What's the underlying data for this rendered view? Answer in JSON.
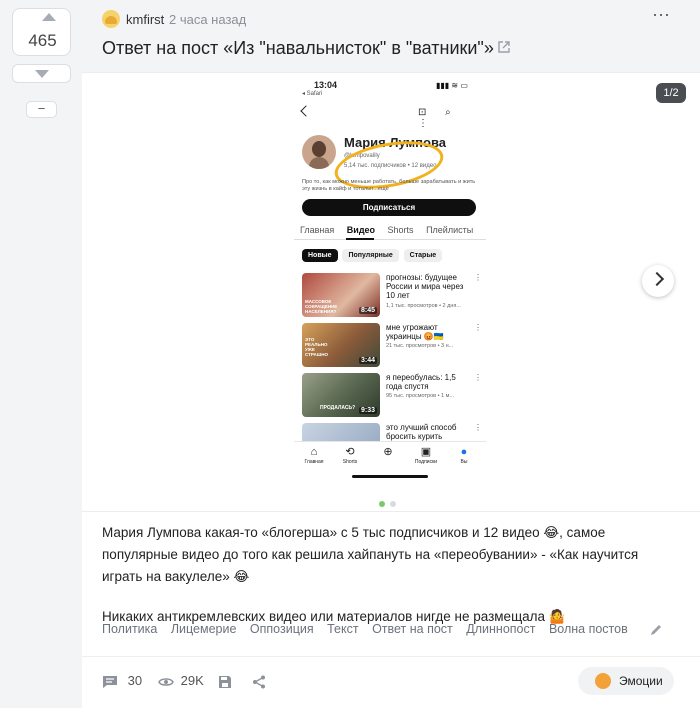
{
  "vote": {
    "count": "465",
    "minus": "−"
  },
  "post": {
    "author": "kmfirst",
    "time": "2 часа назад",
    "title": "Ответ на пост «Из \"навальнисток\" в \"ватники\"»",
    "gallery_counter": "1/2",
    "paragraphs": [
      "Мария Лумпова какая-то «блогерша» с 5 тыс подписчиков и 12 видео 😂, самое популярные видео до того как решила хайпануть на «переобувании» - «Как научится играть на вакулеле» 😂",
      "Никаких антикремлевских видео или материалов нигде не размещала 🤷"
    ],
    "tags": [
      "Политика",
      "Лицемерие",
      "Оппозиция",
      "Текст",
      "Ответ на пост",
      "Длиннопост",
      "Волна постов"
    ]
  },
  "footer": {
    "comments": "30",
    "views": "29K",
    "emotions_label": "Эмоции"
  },
  "phone": {
    "time": "13:04",
    "back_app": "◂ Safari",
    "status_icons": "▮▮▮ ≋ ▭",
    "nav_icons": "⊡ ⌕ ⋮",
    "channel_name": "Мария Лумпова",
    "handle": "@lumpovalily",
    "stats": "5,14 тыс. подписчиков • 12 видео",
    "description": "Про то, как можно меньше работать, больше зарабатывать и жить эту жизнь в кайф и тотальн...ещё",
    "subscribe": "Подписаться",
    "tabs": [
      "Главная",
      "Видео",
      "Shorts",
      "Плейлисты"
    ],
    "chips": [
      "Новые",
      "Популярные",
      "Старые"
    ],
    "videos": [
      {
        "title": "прогнозы: будущее России и мира через 10 лет",
        "meta": "1,1 тыс. просмотров • 2 дня...",
        "duration": "8:45",
        "caption": "МАССОВОЕ СОКРАЩЕНИЕ НАСЕЛЕНИЯ?"
      },
      {
        "title": "мне угрожают украинцы 😡🇺🇦",
        "meta": "21 тыс. просмотров • 3 н...",
        "duration": "3:44",
        "caption": "ЭТО РЕАЛЬНО УЖЕ СТРАШНО"
      },
      {
        "title": "я переобулась: 1,5 года спустя",
        "meta": "95 тыс. просмотров • 1 м...",
        "duration": "9:33",
        "caption": "ПРОДАЛАСЬ?"
      },
      {
        "title": "это лучший способ бросить курить",
        "meta": "",
        "duration": "",
        "caption": ""
      }
    ],
    "bottom_nav": [
      "Главная",
      "Shorts",
      "",
      "Подписки",
      "Вы"
    ]
  },
  "icons": {
    "upvote": "arrow-up-icon",
    "downvote": "arrow-down-icon",
    "more": "more-dots-icon",
    "external": "external-link-icon",
    "next": "chevron-right-icon",
    "edit": "pencil-icon",
    "comments": "comment-icon",
    "views": "eye-icon",
    "save": "floppy-icon",
    "share": "share-icon"
  },
  "colors": {
    "accent_dot": "#7bc86c",
    "highlight": "#f2b21c"
  }
}
